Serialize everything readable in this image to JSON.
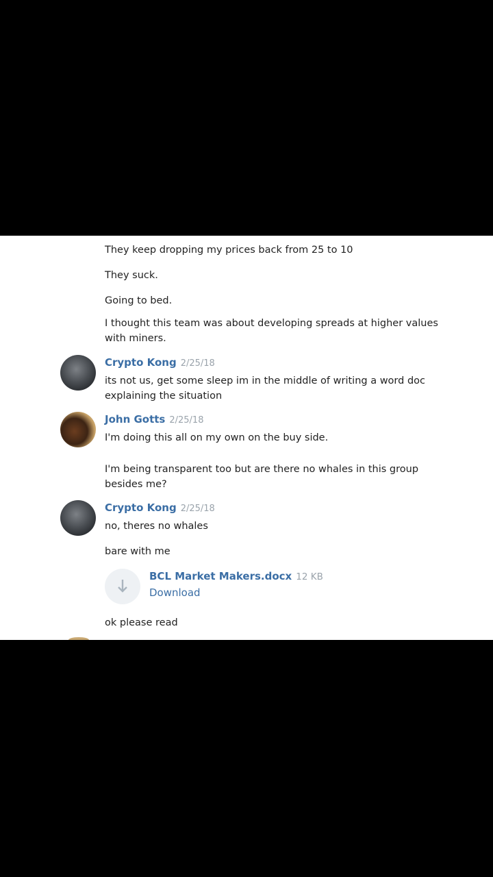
{
  "messages_top": [
    "They keep dropping my prices back from 25 to 10",
    "They suck.",
    "Going to bed.",
    "I thought this team was about developing spreads at higher values with miners."
  ],
  "groups": [
    {
      "sender": "Crypto Kong",
      "date": "2/25/18",
      "messages": [
        "its not us, get some sleep im in the middle of writing a word doc explaining the situation"
      ]
    },
    {
      "sender": "John Gotts",
      "date": "2/25/18",
      "messages": [
        "I'm doing this all on my own on the buy side.",
        "I'm being transparent too but are there no whales in this group besides me?"
      ]
    },
    {
      "sender": "Crypto Kong",
      "date": "2/25/18",
      "messages": [
        "no, theres no whales",
        "bare with me"
      ],
      "file": {
        "name": "BCL Market Makers.docx",
        "size": "12 KB",
        "action": "Download",
        "icon": "download-arrow-icon"
      },
      "after_file": "ok please read"
    }
  ],
  "colors": {
    "sender": "#3b6ea5",
    "date": "#9aa3ab",
    "text": "#222222",
    "background": "#ffffff",
    "letterbox": "#000000"
  }
}
